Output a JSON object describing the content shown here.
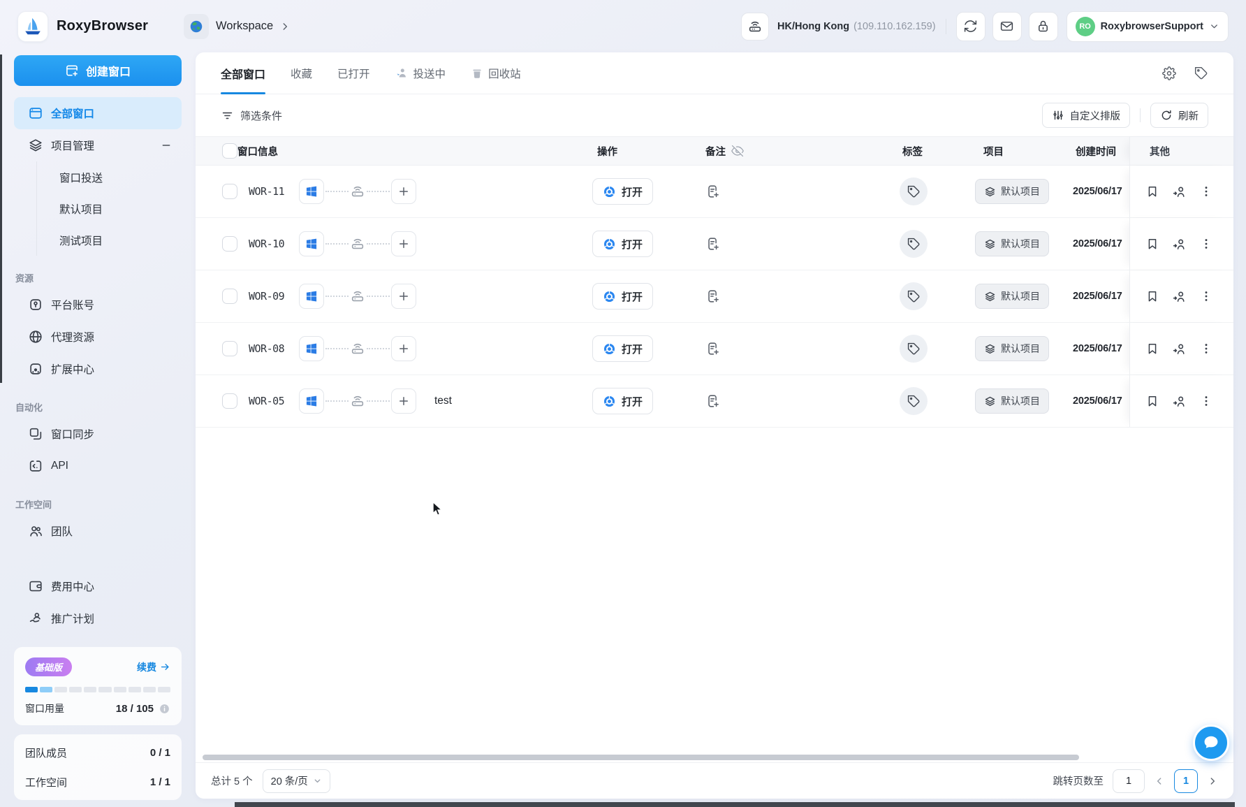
{
  "app": {
    "name": "RoxyBrowser"
  },
  "header": {
    "workspace_label": "Workspace",
    "proxy_location": "HK/Hong Kong",
    "proxy_ip": "(109.110.162.159)",
    "account_initials": "RO",
    "account_name": "RoxybrowserSupport"
  },
  "sidebar": {
    "create_window": "创建窗口",
    "all_windows": "全部窗口",
    "project_mgmt": "项目管理",
    "project_children": [
      {
        "label": "窗口投送"
      },
      {
        "label": "默认项目"
      },
      {
        "label": "测试项目"
      }
    ],
    "section_resources": "资源",
    "platform_accounts": "平台账号",
    "proxy_resources": "代理资源",
    "extension_center": "扩展中心",
    "section_automation": "自动化",
    "window_sync": "窗口同步",
    "api": "API",
    "section_workspace": "工作空间",
    "team": "团队",
    "billing_center": "费用中心",
    "referral_program": "推广计划",
    "plan": {
      "badge": "基础版",
      "renew": "续费",
      "usage_label": "窗口用量",
      "usage_value": "18 / 105",
      "progress": {
        "total": 10,
        "full": 1,
        "partial": 1
      }
    },
    "stats": [
      {
        "label": "团队成员",
        "value": "0 / 1"
      },
      {
        "label": "工作空间",
        "value": "1 / 1"
      }
    ]
  },
  "main": {
    "tabs": [
      {
        "label": "全部窗口"
      },
      {
        "label": "收藏"
      },
      {
        "label": "已打开"
      },
      {
        "label": "投送中"
      },
      {
        "label": "回收站"
      }
    ],
    "filter": "筛选条件",
    "custom_layout": "自定义排版",
    "refresh": "刷新",
    "table": {
      "columns": {
        "info": "窗口信息",
        "action": "操作",
        "note": "备注",
        "tag": "标签",
        "project": "项目",
        "created": "创建时间",
        "other": "其他"
      },
      "open_label": "打开",
      "rows": [
        {
          "id": "WOR-11",
          "name": "",
          "project": "默认项目",
          "created": "2025/06/17"
        },
        {
          "id": "WOR-10",
          "name": "",
          "project": "默认项目",
          "created": "2025/06/17"
        },
        {
          "id": "WOR-09",
          "name": "",
          "project": "默认项目",
          "created": "2025/06/17"
        },
        {
          "id": "WOR-08",
          "name": "",
          "project": "默认项目",
          "created": "2025/06/17"
        },
        {
          "id": "WOR-05",
          "name": "test",
          "project": "默认项目",
          "created": "2025/06/17"
        }
      ]
    },
    "footer": {
      "total": "总计 5 个",
      "page_size": "20 条/页",
      "jump_label": "跳转页数至",
      "jump_value": "1",
      "current_page": "1"
    }
  },
  "colors": {
    "primary": "#1e9af0",
    "active_blue": "#1488e8",
    "avatar_green": "#5ece85",
    "plan_badge_from": "#9d7bf2",
    "plan_badge_to": "#c97ef0"
  }
}
